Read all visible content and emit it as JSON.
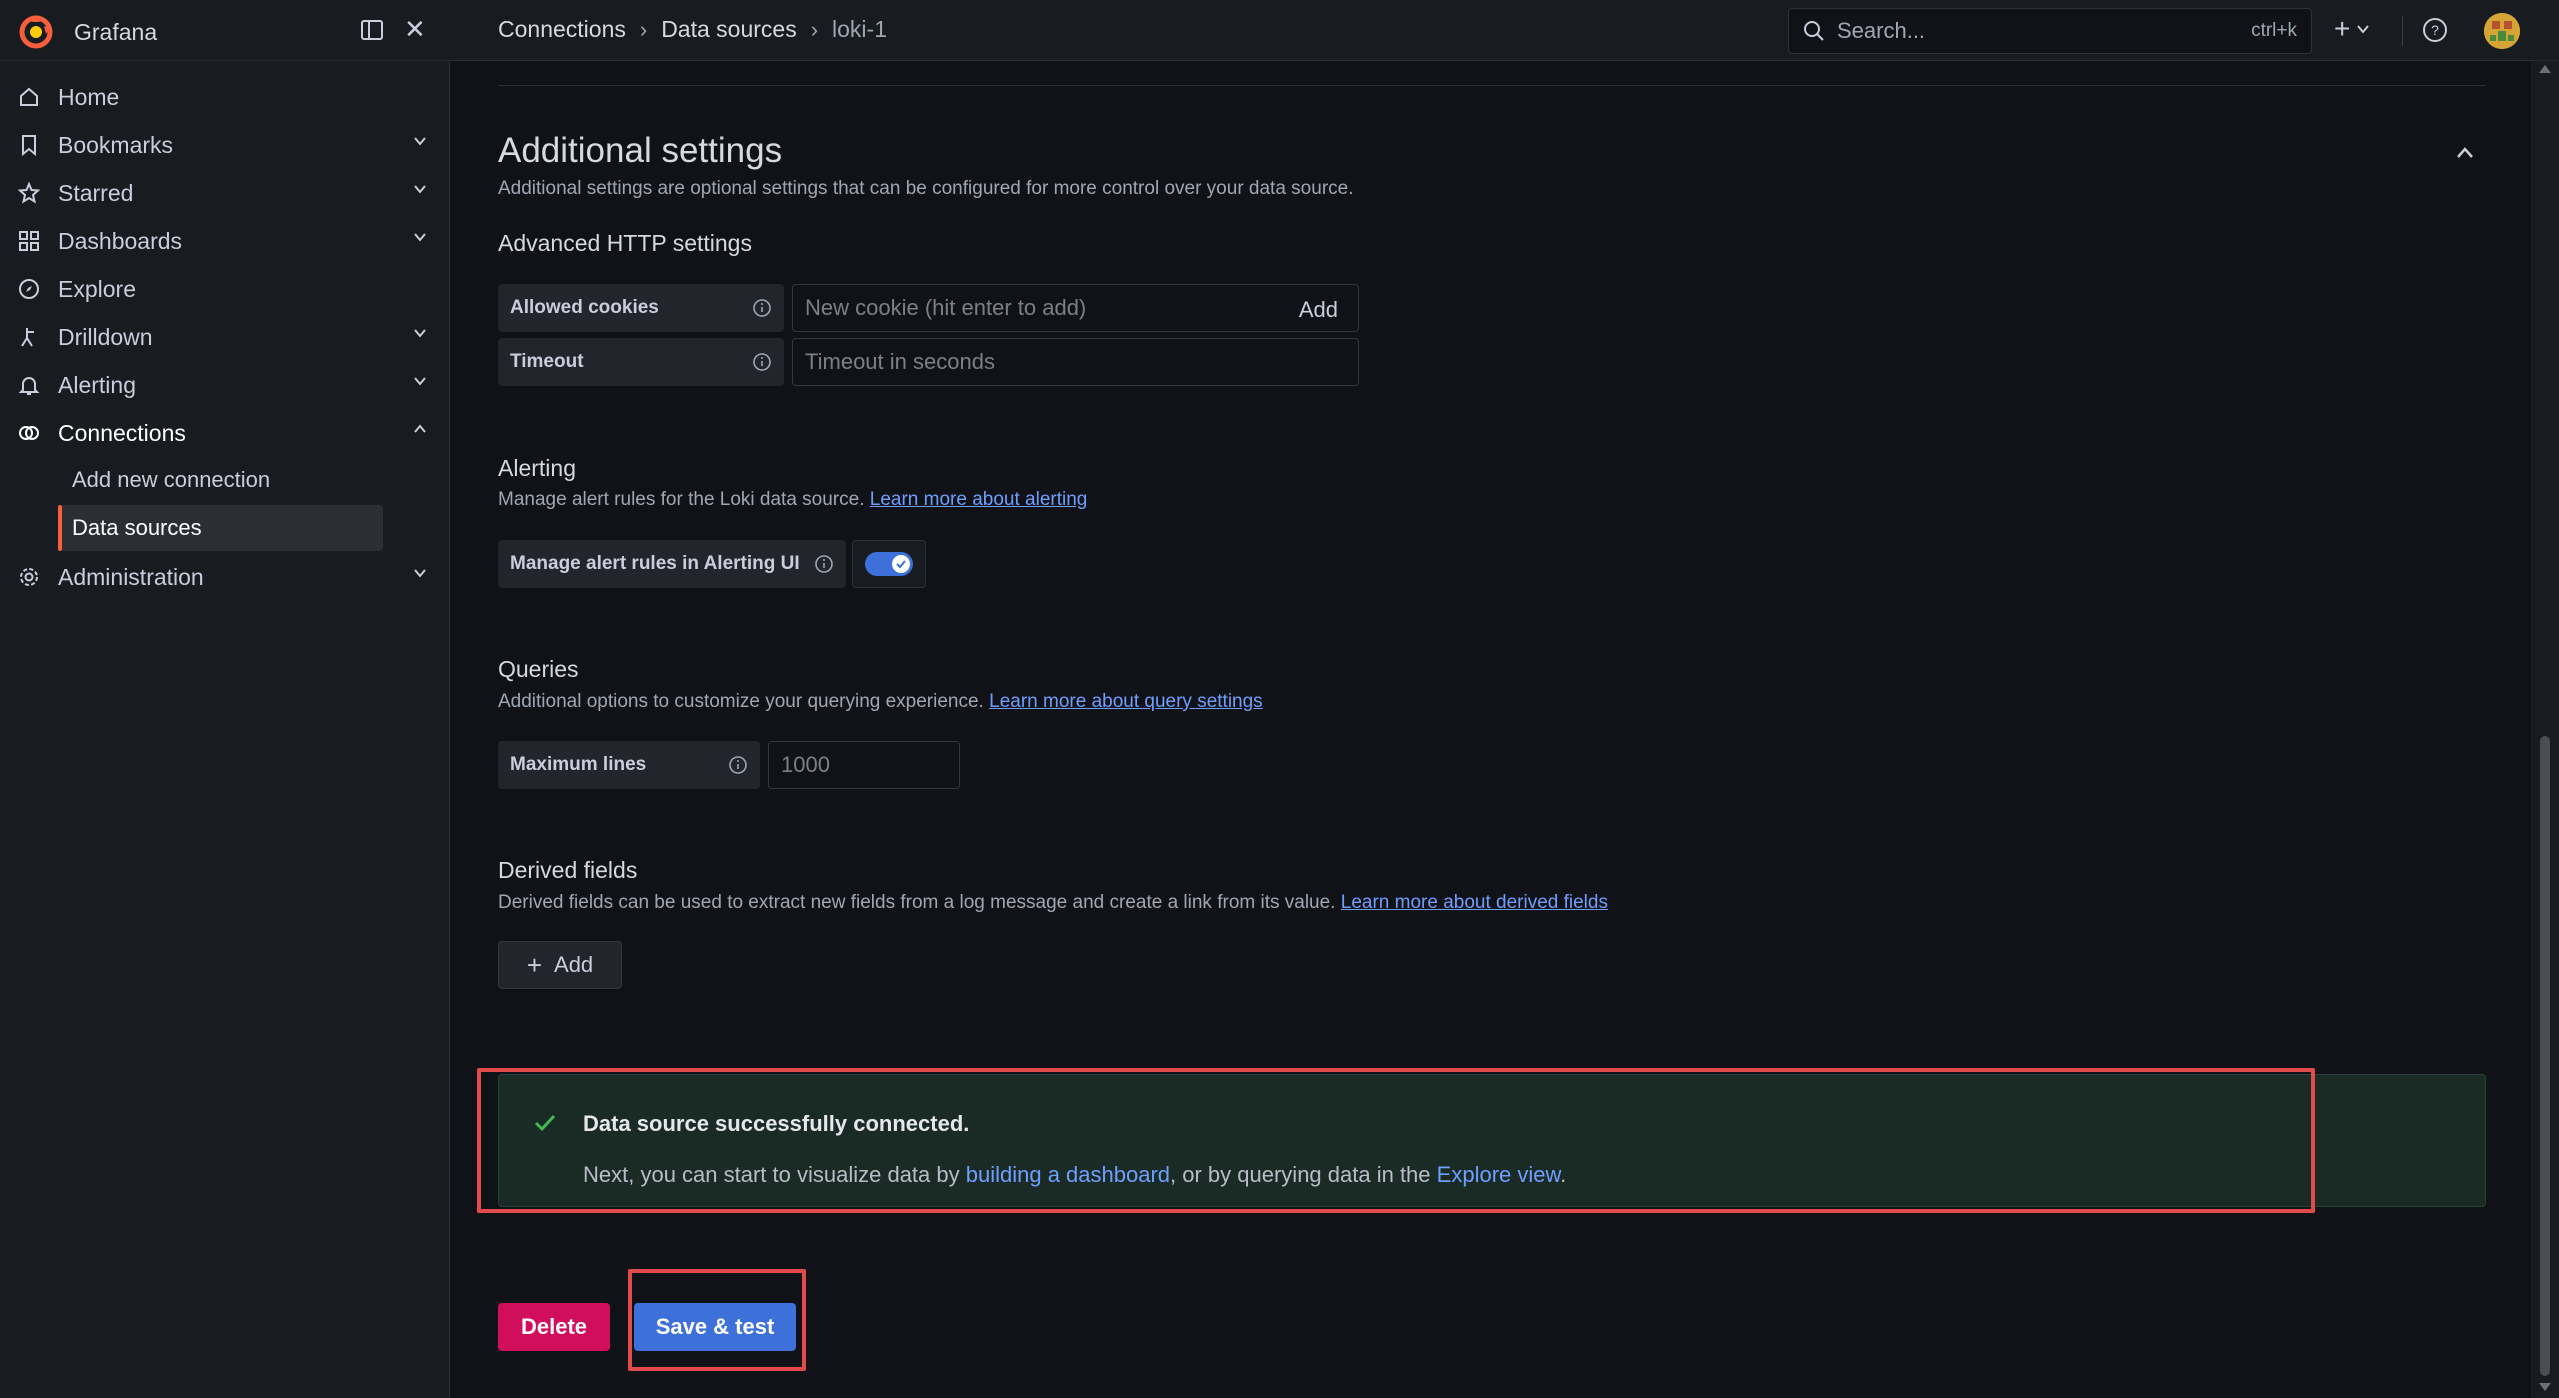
{
  "app": {
    "title": "Grafana"
  },
  "breadcrumb": [
    "Connections",
    "Data sources",
    "loki-1"
  ],
  "search": {
    "placeholder": "Search...",
    "shortcut": "ctrl+k"
  },
  "colors": {
    "accent": "#3d71d9",
    "danger": "#d10e5c",
    "brand": "#f55f3e",
    "success": "#3fb950",
    "highlight": "#e14b4b"
  },
  "sidebar": {
    "items": [
      {
        "label": "Home",
        "icon": "home-icon"
      },
      {
        "label": "Bookmarks",
        "icon": "bookmark-icon"
      },
      {
        "label": "Starred",
        "icon": "star-icon"
      },
      {
        "label": "Dashboards",
        "icon": "dashboards-icon"
      },
      {
        "label": "Explore",
        "icon": "compass-icon"
      },
      {
        "label": "Drilldown",
        "icon": "drilldown-icon"
      },
      {
        "label": "Alerting",
        "icon": "bell-icon"
      },
      {
        "label": "Connections",
        "icon": "connections-icon"
      },
      {
        "label": "Administration",
        "icon": "gear-icon"
      }
    ],
    "connections_sub": [
      "Add new connection",
      "Data sources"
    ]
  },
  "additional_settings": {
    "title": "Additional settings",
    "description": "Additional settings are optional settings that can be configured for more control over your data source."
  },
  "http": {
    "title": "Advanced HTTP settings",
    "cookies_label": "Allowed cookies",
    "cookies_placeholder": "New cookie (hit enter to add)",
    "cookies_add": "Add",
    "timeout_label": "Timeout",
    "timeout_placeholder": "Timeout in seconds"
  },
  "alerting": {
    "title": "Alerting",
    "description": "Manage alert rules for the Loki data source.",
    "link": "Learn more about alerting",
    "toggle_label": "Manage alert rules in Alerting UI",
    "toggle_on": true
  },
  "queries": {
    "title": "Queries",
    "description": "Additional options to customize your querying experience.",
    "link": "Learn more about query settings",
    "max_lines_label": "Maximum lines",
    "max_lines_placeholder": "1000"
  },
  "derived": {
    "title": "Derived fields",
    "description": "Derived fields can be used to extract new fields from a log message and create a link from its value.",
    "link": "Learn more about derived fields",
    "add_label": "Add"
  },
  "alert": {
    "title": "Data source successfully connected.",
    "body_pre": "Next, you can start to visualize data by ",
    "link1": "building a dashboard",
    "body_mid": ", or by querying data in the ",
    "link2": "Explore view",
    "body_post": "."
  },
  "actions": {
    "delete": "Delete",
    "save": "Save & test"
  }
}
